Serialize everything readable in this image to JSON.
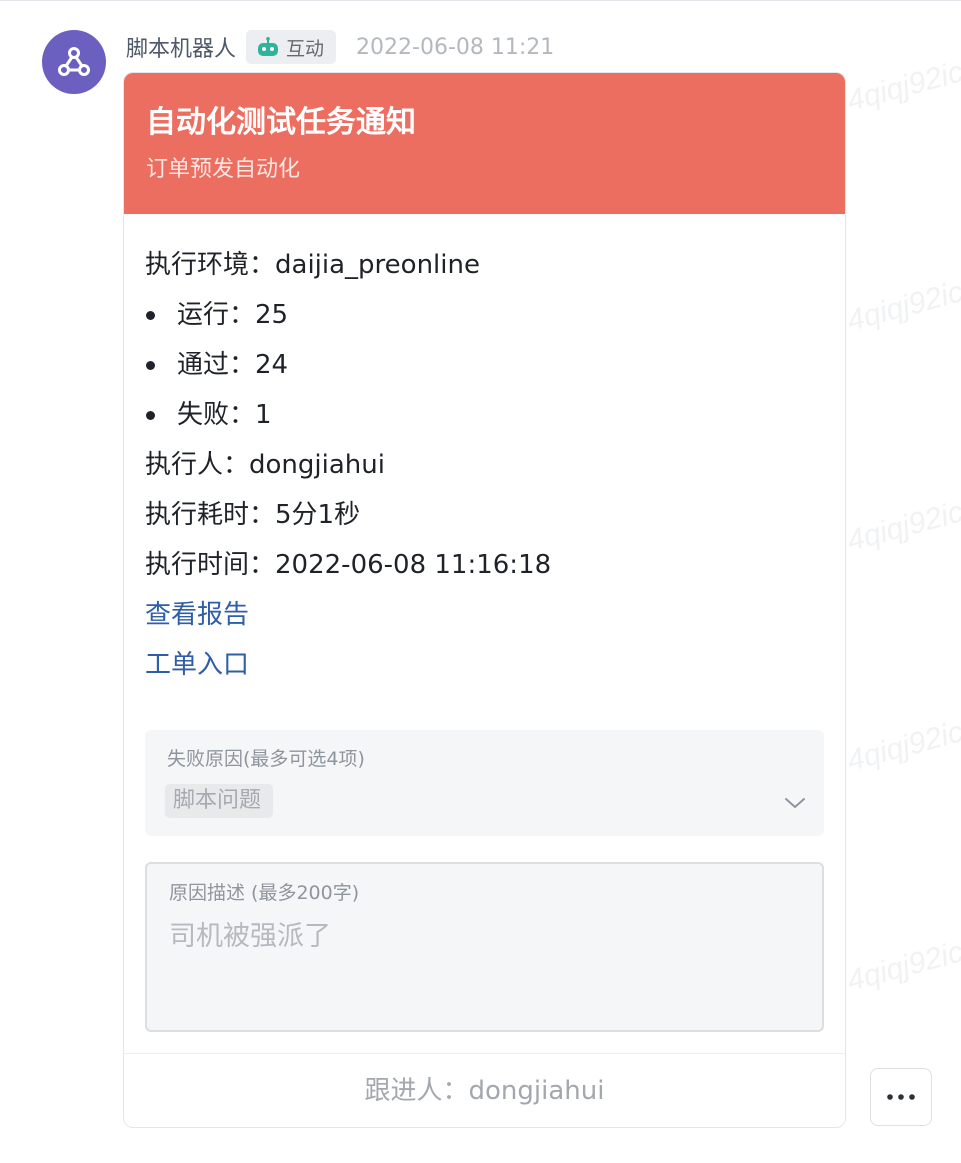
{
  "message": {
    "sender": "脚本机器人",
    "tag": "互动",
    "time": "2022-06-08 11:21"
  },
  "card": {
    "title": "自动化测试任务通知",
    "subtitle": "订单预发自动化",
    "env_label": "执行环境：",
    "env_value": "daijia_preonline",
    "stats": [
      {
        "label": "运行：",
        "value": "25"
      },
      {
        "label": "通过：",
        "value": "24"
      },
      {
        "label": "失败：",
        "value": "1"
      }
    ],
    "executor_label": "执行人：",
    "executor_value": "dongjiahui",
    "duration_label": "执行耗时：",
    "duration_value": "5分1秒",
    "exec_time_label": "执行时间：",
    "exec_time_value": "2022-06-08 11:16:18",
    "links": {
      "report": "查看报告",
      "ticket": "工单入口"
    },
    "fail_reason": {
      "label": "失败原因(最多可选4项)",
      "selected": "脚本问题"
    },
    "reason_desc": {
      "label": "原因描述 (最多200字)",
      "value": "司机被强派了"
    },
    "footer": "跟进人：dongjiahui"
  },
  "icons": {
    "avatar": "webhook-icon",
    "tag": "robot-icon",
    "select": "chevron-down-icon",
    "more": "more-horizontal-icon"
  },
  "colors": {
    "header": "#ec6e61",
    "avatar": "#6b5fc0",
    "link": "#2f5ea8"
  },
  "watermark": "4qiqj92ic"
}
